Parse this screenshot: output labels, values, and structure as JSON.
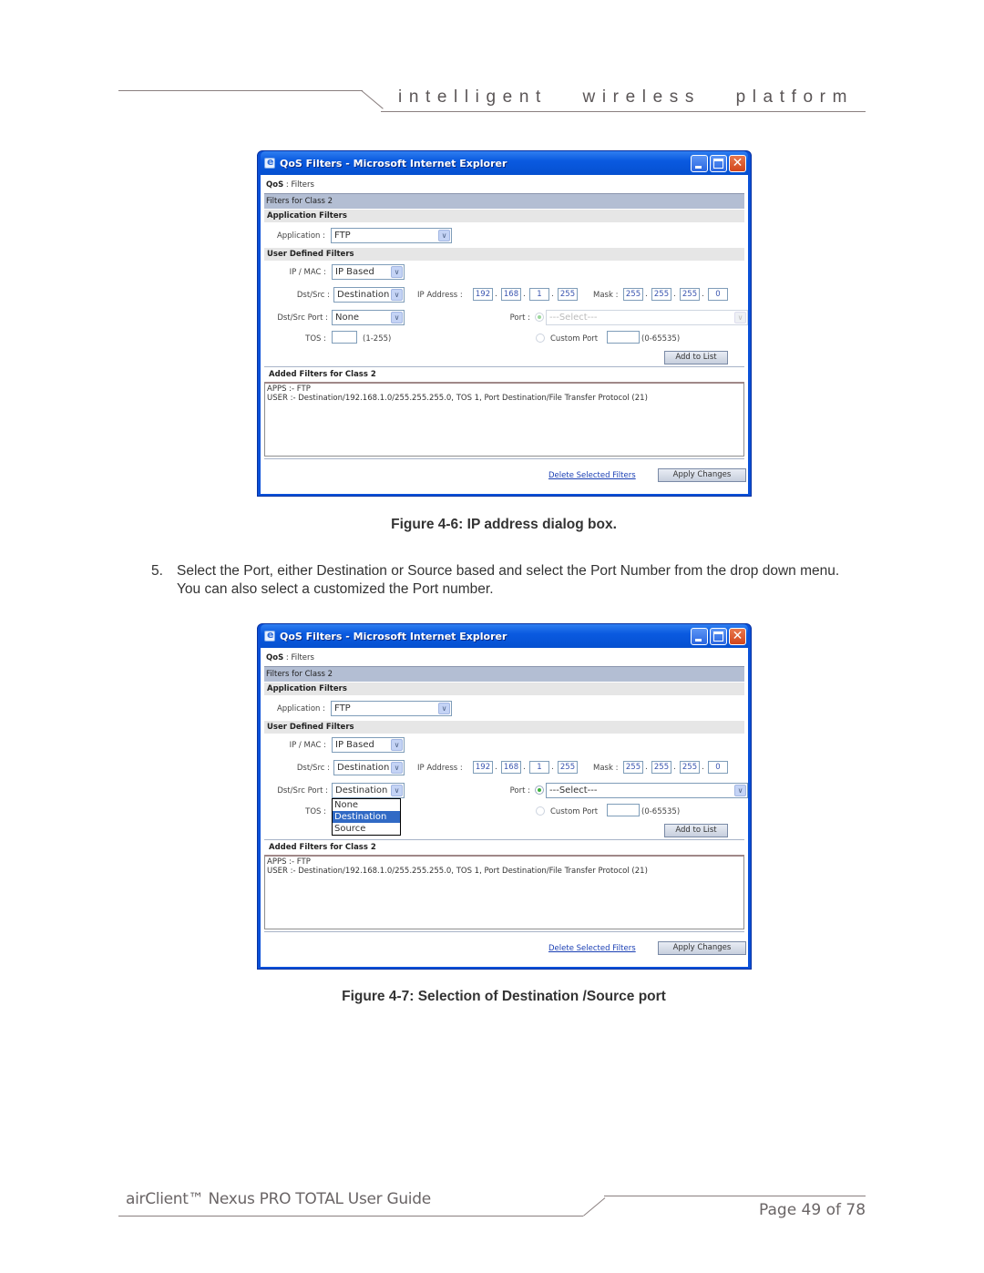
{
  "page": {
    "header_tagline": "intelligent   wireless   platform",
    "footer_title": "airClient™ Nexus PRO TOTAL User Guide",
    "footer_page": "Page 49 of 78"
  },
  "figure6_caption": "Figure 4-6: IP address dialog box.",
  "step": {
    "number": "5.",
    "text": "Select the Port, either Destination or Source based and select the Port Number from the drop down menu. You can also select a customized the Port number."
  },
  "figure7_caption": "Figure 4-7: Selection of Destination /Source port",
  "dialogs": [
    {
      "window_title": "QoS Filters - Microsoft Internet Explorer",
      "breadcrumb_root": "QoS",
      "breadcrumb_sep": " : ",
      "breadcrumb_page": "Filters",
      "class_header": "Filters for Class 2",
      "app_filters_title": "Application Filters",
      "application_label": "Application :",
      "application_value": "FTP",
      "user_filters_title": "User Defined Filters",
      "ipmac_label": "IP / MAC :",
      "ipmac_value": "IP Based",
      "dstsrc_label": "Dst/Src :",
      "dstsrc_value": "Destination",
      "ip_label": "IP Address :",
      "ip": [
        "192",
        "168",
        "1",
        "255"
      ],
      "mask_label": "Mask :",
      "mask": [
        "255",
        "255",
        "255",
        "0"
      ],
      "port_mode_label": "Dst/Src Port :",
      "port_mode_value": "None",
      "port_label": "Port :",
      "port_value": "---Select---",
      "port_disabled": true,
      "tos_label": "TOS :",
      "tos_value": "",
      "tos_hint": "(1-255)",
      "custom_port_label": "Custom Port",
      "custom_port_value": "",
      "custom_port_hint": "(0-65535)",
      "add_button": "Add to List",
      "added_title": "Added Filters for Class 2",
      "added_lines": [
        "APPS :- FTP",
        "USER :- Destination/192.168.1.0/255.255.255.0, TOS 1, Port Destination/File Transfer Protocol (21)"
      ],
      "delete_link": "Delete Selected Filters",
      "apply_button": "Apply Changes"
    },
    {
      "window_title": "QoS Filters - Microsoft Internet Explorer",
      "breadcrumb_root": "QoS",
      "breadcrumb_sep": " : ",
      "breadcrumb_page": "Filters",
      "class_header": "Filters for Class 2",
      "app_filters_title": "Application Filters",
      "application_label": "Application :",
      "application_value": "FTP",
      "user_filters_title": "User Defined Filters",
      "ipmac_label": "IP / MAC :",
      "ipmac_value": "IP Based",
      "dstsrc_label": "Dst/Src :",
      "dstsrc_value": "Destination",
      "ip_label": "IP Address :",
      "ip": [
        "192",
        "168",
        "1",
        "255"
      ],
      "mask_label": "Mask :",
      "mask": [
        "255",
        "255",
        "255",
        "0"
      ],
      "port_mode_label": "Dst/Src Port :",
      "port_mode_value": "Destination",
      "port_mode_options": [
        "None",
        "Destination",
        "Source"
      ],
      "port_mode_highlighted": "Destination",
      "port_label": "Port :",
      "port_value": "---Select---",
      "port_disabled": false,
      "tos_label": "TOS :",
      "tos_value": "",
      "tos_hint": "(1-255)",
      "custom_port_label": "Custom Port",
      "custom_port_value": "",
      "custom_port_hint": "(0-65535)",
      "add_button": "Add to List",
      "added_title": "Added Filters for Class 2",
      "added_lines": [
        "APPS :- FTP",
        "USER :- Destination/192.168.1.0/255.255.255.0, TOS 1, Port Destination/File Transfer Protocol (21)"
      ],
      "delete_link": "Delete Selected Filters",
      "apply_button": "Apply Changes"
    }
  ]
}
